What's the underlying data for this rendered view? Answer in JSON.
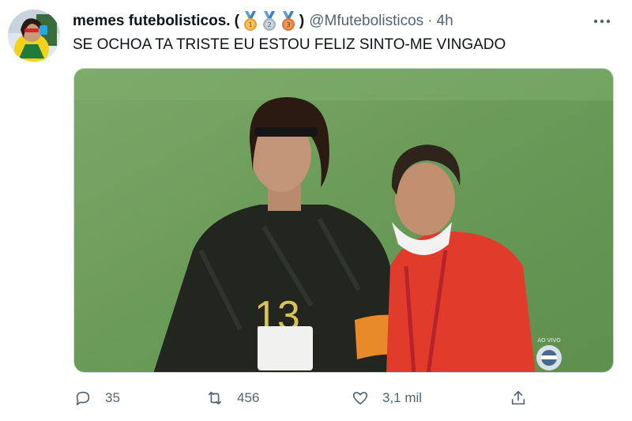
{
  "tweet": {
    "author_name": "memes futebolisticos.",
    "paren_open": "(",
    "paren_close": ")",
    "handle": "@Mfutebolisticos",
    "separator": "·",
    "time": "4h",
    "text": "SE OCHOA TA TRISTE EU ESTOU FELIZ SINTO-ME VINGADO",
    "medals": [
      "1",
      "2",
      "3"
    ],
    "media": {
      "live_label": "AO VIVO",
      "jersey_number": "13"
    }
  },
  "actions": {
    "reply_count": "35",
    "retweet_count": "456",
    "like_count": "3,1 mil"
  },
  "colors": {
    "text": "#0f1419",
    "secondary": "#536471",
    "field_green": "#6e9e5c",
    "medal_gold": "#e6a43a",
    "medal_silver": "#a9b6c2",
    "medal_bronze": "#d97a3a"
  },
  "icons": {
    "reply": "speech-bubble-icon",
    "retweet": "retweet-icon",
    "like": "heart-icon",
    "share": "share-icon",
    "more": "ellipsis-icon"
  }
}
